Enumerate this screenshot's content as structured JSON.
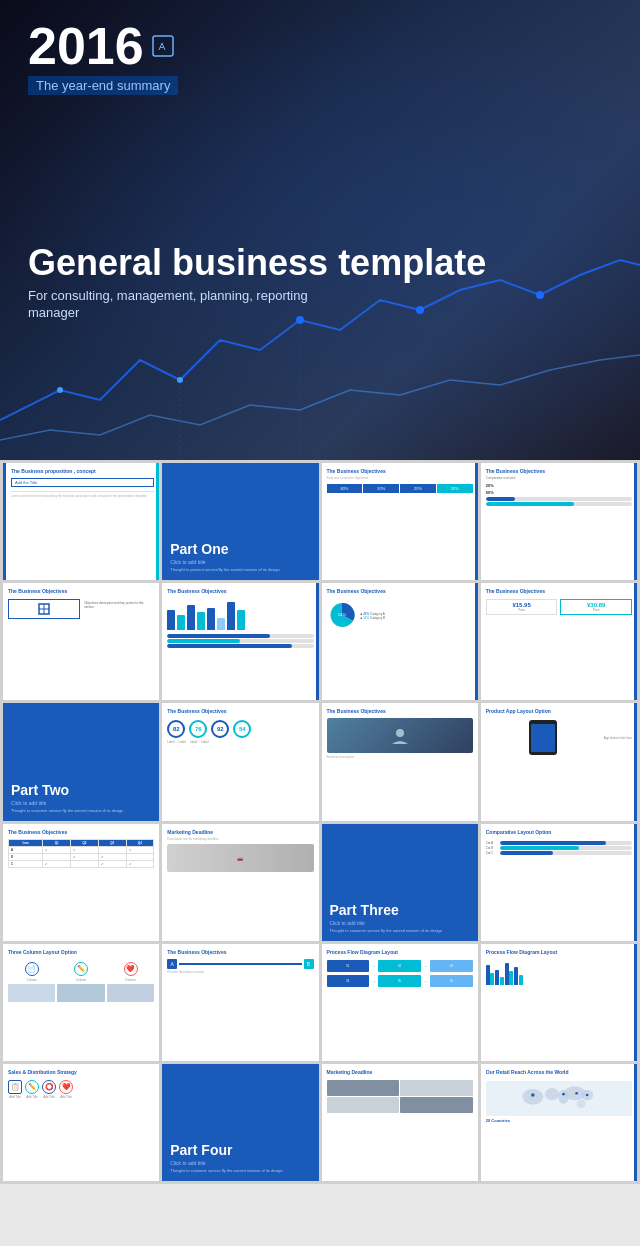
{
  "hero": {
    "year": "2016",
    "subtitle": "The year-end summary",
    "title": "General business template",
    "description": "For consulting, management, planning, reporting",
    "manager_label": "manager"
  },
  "slides": [
    {
      "id": "s1",
      "type": "concept",
      "title": "The Business proposition , concept",
      "subtitle": "Add the Title"
    },
    {
      "id": "s2",
      "type": "part",
      "part": "Part One",
      "click": "Click to add title",
      "desc": "Thought to present service/fly the sacred mission of its design"
    },
    {
      "id": "s3",
      "type": "objectives-table",
      "title": "The Business Objectives"
    },
    {
      "id": "s4",
      "type": "objectives-progress",
      "title": "The Business Objectives"
    },
    {
      "id": "s5",
      "type": "objectives-grid",
      "title": "The Business Objectives"
    },
    {
      "id": "s6",
      "type": "objectives-bars",
      "title": "The Business Objectives"
    },
    {
      "id": "s7",
      "type": "objectives-pie",
      "title": "The Business Objectives"
    },
    {
      "id": "s8",
      "type": "objectives-price",
      "title": "The Business Objectives"
    },
    {
      "id": "s9",
      "type": "part2",
      "part": "Part Two",
      "click": "Click to add title",
      "desc": "Thought to customer service fly the sacred mission of its design"
    },
    {
      "id": "s10",
      "type": "circle-nums",
      "title": "The Business Objectives",
      "numbers": [
        "82",
        "76",
        "92",
        "54"
      ]
    },
    {
      "id": "s11",
      "type": "objectives-person",
      "title": "The Business Objectives"
    },
    {
      "id": "s12",
      "type": "product-app",
      "title": "Product App Layout Option"
    },
    {
      "id": "s13",
      "type": "objectives-table2",
      "title": "The Business Objectives"
    },
    {
      "id": "s14",
      "type": "marketing",
      "title": "Marketing Deadline"
    },
    {
      "id": "s15",
      "type": "part3",
      "part": "Part Three",
      "click": "Click to add title",
      "desc": "Thought to customer service fly the sacred mission of its design"
    },
    {
      "id": "s16",
      "type": "comparative",
      "title": "Comparative Layout Option"
    },
    {
      "id": "s17",
      "type": "three-col",
      "title": "Three Column Layout Option"
    },
    {
      "id": "s18",
      "type": "objectives-icons",
      "title": "The Business Objectives"
    },
    {
      "id": "s19",
      "type": "flow-diagram",
      "title": "Process Flow Diagram Layout"
    },
    {
      "id": "s20",
      "type": "flow-diagram2",
      "title": "Process Flow Diagram Layout"
    },
    {
      "id": "s21",
      "type": "sales-dist",
      "title": "Sales & Distribution Strategy"
    },
    {
      "id": "s22",
      "type": "part4",
      "part": "Part Four",
      "click": "Click to add title",
      "desc": "Thought to customer service fly the sacred mission of its design"
    },
    {
      "id": "s23",
      "type": "marketing2",
      "title": "Marketing Deadline"
    },
    {
      "id": "s24",
      "type": "world-map",
      "title": "Our Retail Reach Across the World"
    }
  ],
  "colors": {
    "blue": "#1a5ab8",
    "teal": "#00bcd4",
    "light_blue": "#64b5f6",
    "dark": "#1a1a2a"
  }
}
